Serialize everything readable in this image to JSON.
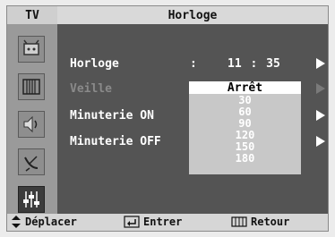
{
  "header": {
    "source": "TV",
    "title": "Horloge"
  },
  "sidebar": {
    "icons": [
      "antenna-icon",
      "picture-icon",
      "sound-icon",
      "satellite-icon",
      "setup-icon"
    ],
    "active": "setup-icon"
  },
  "menu": {
    "rows": [
      {
        "label": "Horloge"
      },
      {
        "label": "Veille"
      },
      {
        "label": "Minuterie ON"
      },
      {
        "label": "Minuterie OFF"
      }
    ],
    "clock": {
      "separator": ":",
      "time": "11 : 35"
    }
  },
  "dropdown": {
    "selected": "Arrêt",
    "options": [
      "30",
      "60",
      "90",
      "120",
      "150",
      "180"
    ]
  },
  "footer": {
    "move": "Déplacer",
    "enter": "Entrer",
    "back": "Retour"
  },
  "colors": {
    "background": "#545454",
    "highlight": "#ffffff",
    "sidebar": "#9a9a9a"
  }
}
